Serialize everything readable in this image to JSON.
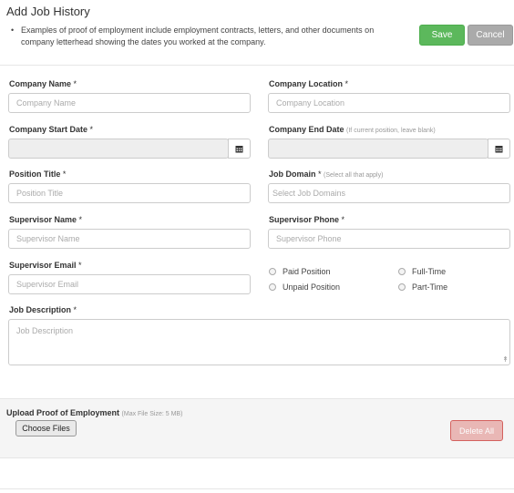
{
  "header": {
    "title": "Add Job History",
    "bullet": "Examples of proof of employment include employment contracts, letters, and other documents on company letterhead showing the dates you worked at the company.",
    "bullet_dot": "•",
    "save_label": "Save",
    "cancel_label": "Cancel"
  },
  "form": {
    "company_name": {
      "label": "Company Name",
      "required": " *",
      "placeholder": "Company Name"
    },
    "company_location": {
      "label": "Company Location",
      "required": " *",
      "placeholder": "Company Location"
    },
    "start_date": {
      "label": "Company Start Date",
      "required": " *"
    },
    "end_date": {
      "label": "Company End Date",
      "hint": "(If current position, leave blank)"
    },
    "position_title": {
      "label": "Position Title",
      "required": " *",
      "placeholder": "Position Title"
    },
    "job_domain": {
      "label": "Job Domain",
      "required": " *",
      "hint": "(Select all that apply)",
      "placeholder": "Select Job Domains"
    },
    "supervisor_name": {
      "label": "Supervisor Name",
      "required": " *",
      "placeholder": "Supervisor Name"
    },
    "supervisor_phone": {
      "label": "Supervisor Phone",
      "required": " *",
      "placeholder": "Supervisor Phone"
    },
    "supervisor_email": {
      "label": "Supervisor Email",
      "required": " *",
      "placeholder": "Supervisor Email"
    },
    "job_description": {
      "label": "Job Description",
      "required": " *",
      "placeholder": "Job Description"
    },
    "radios": {
      "paid": "Paid Position",
      "unpaid": "Unpaid Position",
      "full_time": "Full-Time",
      "part_time": "Part-Time"
    }
  },
  "upload": {
    "label": "Upload Proof of Employment",
    "hint": "(Max File Size: 5 MB)",
    "choose_label": "Choose Files",
    "delete_label": "Delete All"
  },
  "icons": {
    "calendar": "calendar-icon"
  },
  "colors": {
    "save": "#5cb85c",
    "cancel": "#aaaaaa",
    "delete": "#d9534f"
  }
}
